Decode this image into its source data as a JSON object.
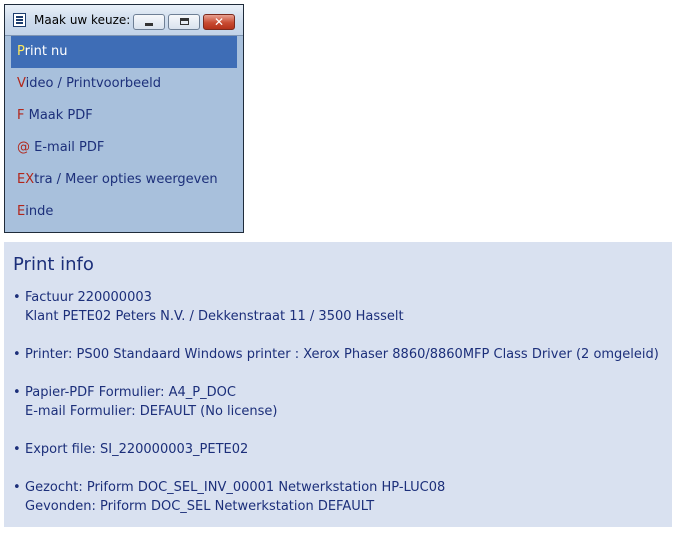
{
  "window": {
    "title": "Maak uw keuze:",
    "controls": {
      "minimize": "minimize",
      "maximize": "maximize",
      "close": "✕"
    }
  },
  "menu": {
    "items": [
      {
        "key": "P",
        "rest": "rint nu",
        "selected": true
      },
      {
        "key": "V",
        "rest": "ideo / Printvoorbeeld"
      },
      {
        "key": "F",
        "rest": " Maak PDF"
      },
      {
        "key": "@",
        "rest": " E-mail PDF"
      },
      {
        "key": "EX",
        "rest": "tra / Meer opties weergeven"
      },
      {
        "key": "E",
        "rest": "inde"
      }
    ]
  },
  "info": {
    "title": "Print info",
    "bullet": "•",
    "factuur": {
      "line1": "Factuur 220000003",
      "line2": "Klant PETE02 Peters N.V. / Dekkenstraat 11 / 3500 Hasselt"
    },
    "printer": {
      "line1": "Printer:  PS00  Standaard Windows printer : Xerox Phaser 8860/8860MFP Class Driver (2 omgeleid)"
    },
    "formulier": {
      "line1": "Papier-PDF Formulier:  A4_P_DOC",
      "line2": "E-mail Formulier:  DEFAULT (No license)"
    },
    "export": {
      "line1": "Export file:  SI_220000003_PETE02"
    },
    "gezocht": {
      "line1": "Gezocht:  Priform DOC_SEL_INV_00001   Netwerkstation HP-LUC08",
      "line2": "Gevonden:  Priform DOC_SEL   Netwerkstation DEFAULT"
    }
  }
}
